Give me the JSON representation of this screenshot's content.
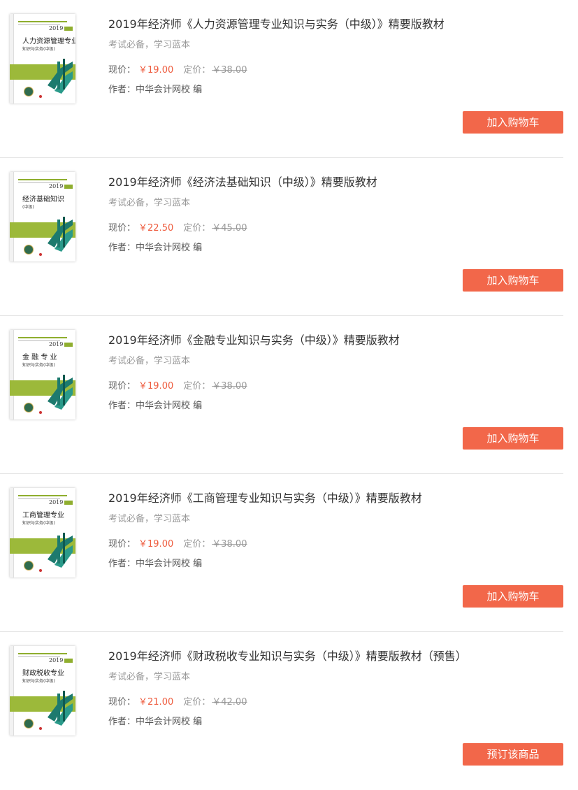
{
  "books": [
    {
      "title": "2019年经济师《人力资源管理专业知识与实务（中级）》精要版教材",
      "slogan": "考试必备，学习蓝本",
      "price_label": "现价：",
      "price_now": "￥19.00",
      "list_label": "定价：",
      "price_list": "￥38.00",
      "author": "作者：中华会计网校 编",
      "button": "加入购物车",
      "cover_title": "人力资源管理专业",
      "cover_sub": "知识与实务(中级)",
      "cover_year": "2019"
    },
    {
      "title": "2019年经济师《经济法基础知识（中级）》精要版教材",
      "slogan": "考试必备，学习蓝本",
      "price_label": "现价：",
      "price_now": "￥22.50",
      "list_label": "定价：",
      "price_list": "￥45.00",
      "author": "作者：中华会计网校 编",
      "button": "加入购物车",
      "cover_title": "经济基础知识",
      "cover_sub": "(中级)",
      "cover_year": "2019"
    },
    {
      "title": "2019年经济师《金融专业知识与实务（中级）》精要版教材",
      "slogan": "考试必备，学习蓝本",
      "price_label": "现价：",
      "price_now": "￥19.00",
      "list_label": "定价：",
      "price_list": "￥38.00",
      "author": "作者：中华会计网校 编",
      "button": "加入购物车",
      "cover_title": "金 融 专 业",
      "cover_sub": "知识与实务(中级)",
      "cover_year": "2019"
    },
    {
      "title": "2019年经济师《工商管理专业知识与实务（中级）》精要版教材",
      "slogan": "考试必备，学习蓝本",
      "price_label": "现价：",
      "price_now": "￥19.00",
      "list_label": "定价：",
      "price_list": "￥38.00",
      "author": "作者：中华会计网校 编",
      "button": "加入购物车",
      "cover_title": "工商管理专业",
      "cover_sub": "知识与实务(中级)",
      "cover_year": "2019"
    },
    {
      "title": "2019年经济师《财政税收专业知识与实务（中级）》精要版教材（预售）",
      "slogan": "考试必备，学习蓝本",
      "price_label": "现价：",
      "price_now": "￥21.00",
      "list_label": "定价：",
      "price_list": "￥42.00",
      "author": "作者：中华会计网校 编",
      "button": "预订该商品",
      "cover_title": "财政税收专业",
      "cover_sub": "知识与实务(中级)",
      "cover_year": "2019"
    }
  ],
  "colors": {
    "accent_button": "#f2674a",
    "price_current": "#ee5a3c",
    "cover_green": "#9cb93a"
  }
}
